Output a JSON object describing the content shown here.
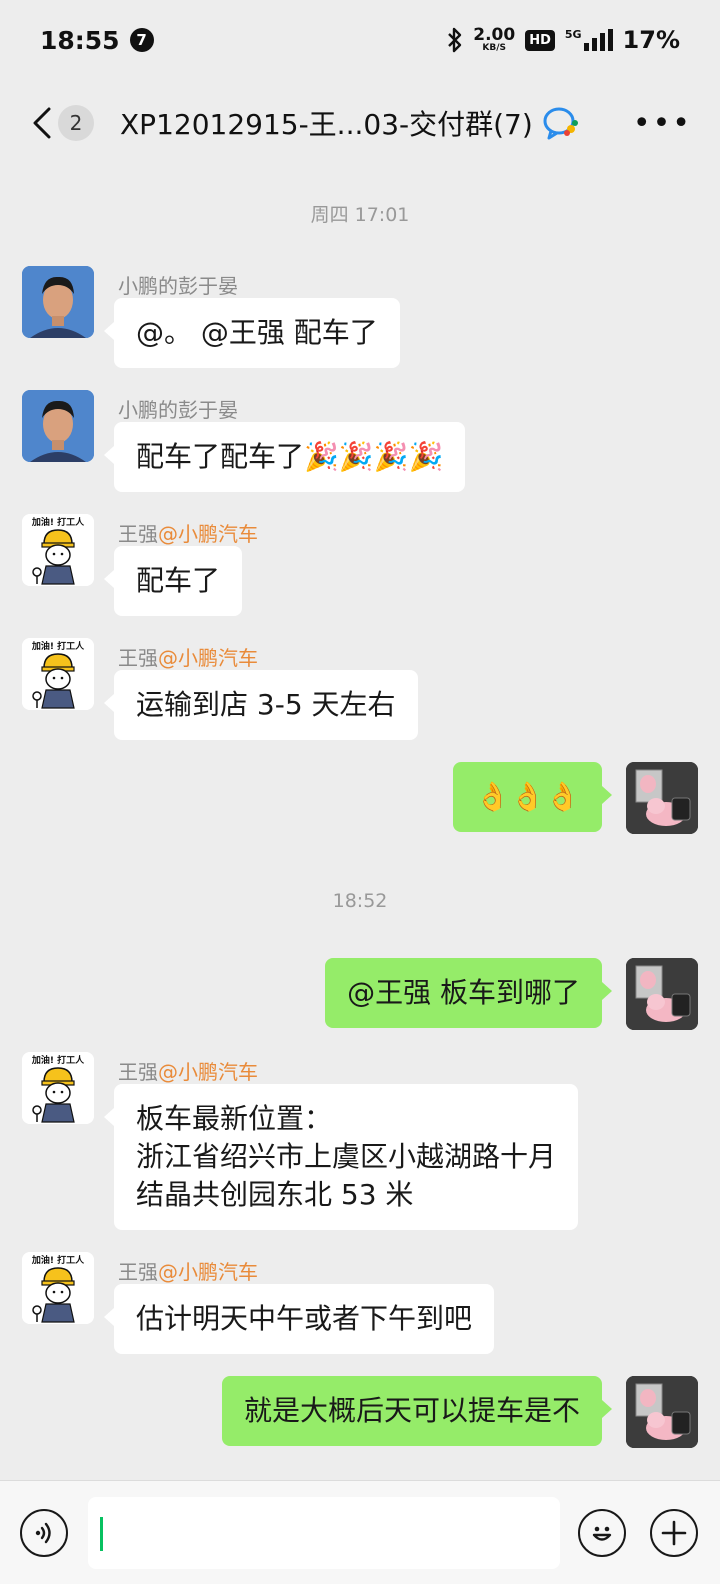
{
  "status_bar": {
    "time": "18:55",
    "notification_count": "7",
    "net_speed_value": "2.00",
    "net_speed_unit": "KB/S",
    "hd_label": "HD",
    "network_label": "5G",
    "battery": "17%"
  },
  "header": {
    "unread_count": "2",
    "title": "XP12012915-王...03-交付群(7)"
  },
  "messages": {
    "ts1": "周四 17:01",
    "m1_sender": "小鹏的彭于晏",
    "m1_text": "@。 @王强  配车了",
    "m2_sender": "小鹏的彭于晏",
    "m2_text": "配车了配车了🎉🎉🎉🎉",
    "m3_sender_name": "王强",
    "m3_sender_org": "@小鹏汽车",
    "m3_text": "配车了",
    "m4_sender_name": "王强",
    "m4_sender_org": "@小鹏汽车",
    "m4_text": "运输到店 3-5 天左右",
    "m5_text": "👌👌👌",
    "ts2": "18:52",
    "m6_text": "@王强  板车到哪了",
    "m7_sender_name": "王强",
    "m7_sender_org": "@小鹏汽车",
    "m7_line1": "板车最新位置：",
    "m7_line2": "浙江省绍兴市上虞区小越湖路十月",
    "m7_line3": "结晶共创园东北 53 米",
    "m8_sender_name": "王强",
    "m8_sender_org": "@小鹏汽车",
    "m8_text": "估计明天中午或者下午到吧",
    "m9_text": "就是大概后天可以提车是不"
  },
  "avatar_badge_text": "加油! 打工人",
  "icons": {
    "back": "chevron-left-icon",
    "more": "more-dots-icon",
    "voice": "voice-icon",
    "emoji": "emoji-icon",
    "add": "plus-icon",
    "group": "wecom-group-icon"
  },
  "colors": {
    "background": "#EDEDED",
    "self_bubble": "#95EC69",
    "other_bubble": "#FFFFFF",
    "org_tag": "#E98B3A",
    "caret": "#07C160"
  }
}
